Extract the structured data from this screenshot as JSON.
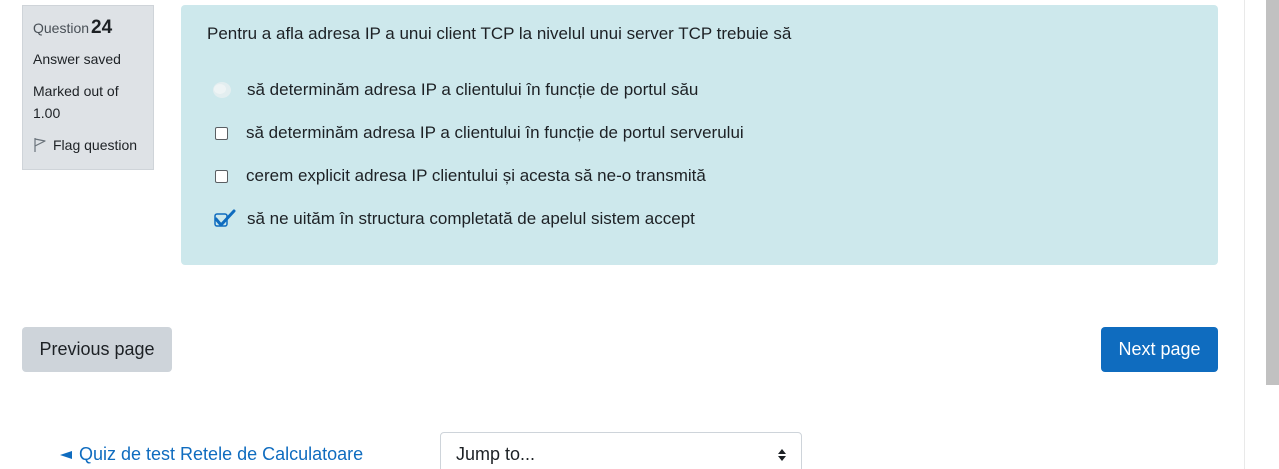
{
  "question_info": {
    "prefix": "Question",
    "number": "24",
    "state": "Answer saved",
    "grade": "Marked out of 1.00",
    "flag_label": "Flag question"
  },
  "question": {
    "text": "Pentru a afla adresa IP a unui client TCP la nivelul unui server TCP trebuie să",
    "options": [
      {
        "label": "să determinăm adresa IP a clientului în funcție de portul său",
        "checked": false,
        "obscured": true
      },
      {
        "label": "să determinăm adresa IP a clientului în funcție de portul serverului",
        "checked": false,
        "obscured": false
      },
      {
        "label": "cerem explicit adresa IP clientului și acesta să ne-o transmită",
        "checked": false,
        "obscured": false
      },
      {
        "label": "să ne uităm în structura completată de apelul sistem accept",
        "checked": true,
        "obscured": false
      }
    ]
  },
  "navigation": {
    "previous_label": "Previous page",
    "next_label": "Next page"
  },
  "footer": {
    "back_link": "Quiz de test Retele de Calculatoare",
    "jump_select": "Jump to..."
  },
  "colors": {
    "content_bg": "#cde8ec",
    "info_bg": "#dee2e6",
    "primary": "#0f6cbf",
    "secondary": "#ced4da"
  },
  "icons": {
    "flag": "flag-outline-icon",
    "checked": "checkmark-icon",
    "back": "triangle-left-icon",
    "select": "select-updown-icon"
  }
}
